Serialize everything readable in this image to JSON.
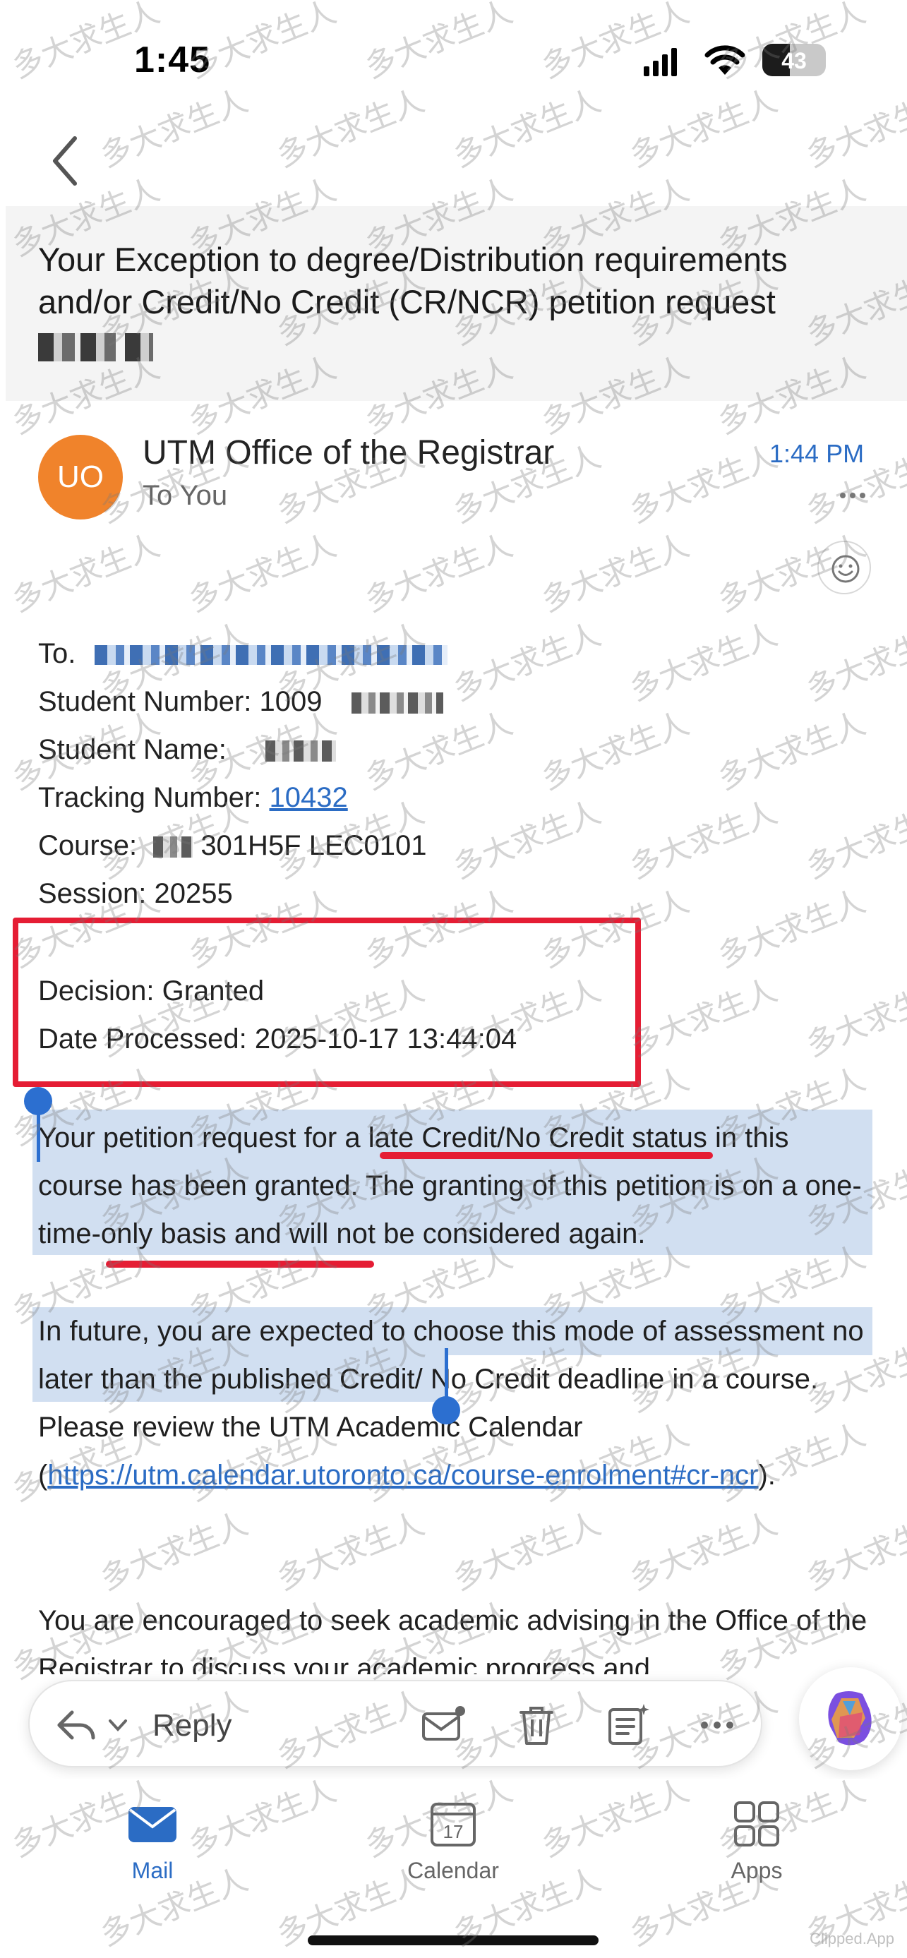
{
  "status_bar": {
    "time": "1:45",
    "battery": "43",
    "battery_level": 0.43
  },
  "email": {
    "subject_part1": "Your Exception to degree/Distribution requirements and/or Credit/No Credit (CR/NCR) petition request",
    "sender_name": "UTM Office of the Registrar",
    "recipient_line": "To You",
    "avatar_initials": "UO",
    "sent_time": "1:44 PM",
    "to_label": "To.",
    "student_number_label": "Student Number: 1009",
    "student_name_label": "Student Name:",
    "tracking_label": "Tracking Number: ",
    "tracking_value": "10432",
    "course_label": "Course:",
    "course_value": "301H5F LEC0101",
    "session_line": "Session: 20255",
    "decision_line": "Decision: Granted",
    "date_processed_line": "Date Processed: 2025-10-17 13:44:04",
    "para1": "Your petition request for a late Credit/No Credit status in this course has been granted. The granting of this petition is on a one-time-only basis and will not be considered again.",
    "para2_text": "In future, you are expected to choose this mode of assessment no later than the published Credit/ No Credit deadline in a course. Please review the UTM Academic Calendar (",
    "para2_link": "https://utm.calendar.utoronto.ca/course-enrolment#cr-ncr",
    "para2_end": ").",
    "para3": "You are encouraged to seek academic advising in the Office of the Registrar to discuss your academic progress and"
  },
  "toolbar": {
    "reply_label": "Reply"
  },
  "tabs": [
    {
      "label": "Mail",
      "active": true
    },
    {
      "label": "Calendar",
      "active": false,
      "day": "17"
    },
    {
      "label": "Apps",
      "active": false
    }
  ],
  "colors": {
    "accent": "#2b6cc4",
    "avatar": "#f0832b",
    "highlight": "#e51d34",
    "selection": "#c9d9ef"
  },
  "watermark": {
    "text": "多大求生人",
    "corner": "Clipped.App"
  }
}
